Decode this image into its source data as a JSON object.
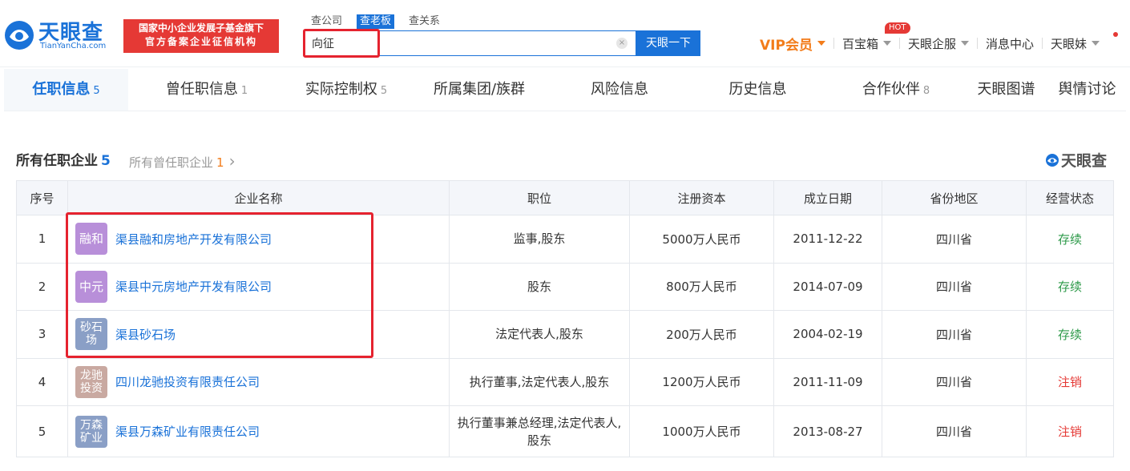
{
  "header": {
    "logo_cn": "天眼查",
    "logo_en": "TianYanCha.com",
    "banner_line1": "国家中小企业发展子基金旗下",
    "banner_line2": "官方备案企业征信机构",
    "search_tabs": [
      "查公司",
      "查老板",
      "查关系"
    ],
    "search_value": "向征",
    "clear_glyph": "×",
    "search_button": "天眼一下",
    "nav": {
      "vip": "VIP会员",
      "hot_badge": "HOT",
      "baibaoxiang": "百宝箱",
      "qifu": "天眼企服",
      "messages": "消息中心",
      "user": "天眼妹"
    }
  },
  "tabs": [
    {
      "label": "任职信息",
      "count": "5"
    },
    {
      "label": "曾任职信息",
      "count": "1"
    },
    {
      "label": "实际控制权",
      "count": "5"
    },
    {
      "label": "所属集团/族群",
      "count": ""
    },
    {
      "label": "风险信息",
      "count": ""
    },
    {
      "label": "历史信息",
      "count": ""
    },
    {
      "label": "合作伙伴",
      "count": "8"
    },
    {
      "label": "天眼图谱",
      "count": ""
    },
    {
      "label": "舆情讨论",
      "count": ""
    }
  ],
  "section": {
    "title": "所有任职企业",
    "count": "5",
    "sub_label": "所有曾任职企业",
    "sub_count": "1",
    "chevron": "›",
    "watermark": "天眼查"
  },
  "table": {
    "headers": [
      "序号",
      "企业名称",
      "职位",
      "注册资本",
      "成立日期",
      "省份地区",
      "经营状态"
    ],
    "rows": [
      {
        "no": "1",
        "avatar_l1": "融和",
        "avatar_l2": "",
        "avatar_color": "#b88fd9",
        "name": "渠县融和房地产开发有限公司",
        "position": "监事,股东",
        "capital": "5000万人民币",
        "date": "2011-12-22",
        "region": "四川省",
        "status": "存续",
        "status_color": "green"
      },
      {
        "no": "2",
        "avatar_l1": "中元",
        "avatar_l2": "",
        "avatar_color": "#b88fd9",
        "name": "渠县中元房地产开发有限公司",
        "position": "股东",
        "capital": "800万人民币",
        "date": "2014-07-09",
        "region": "四川省",
        "status": "存续",
        "status_color": "green"
      },
      {
        "no": "3",
        "avatar_l1": "砂石",
        "avatar_l2": "场",
        "avatar_color": "#8a9fc6",
        "name": "渠县砂石场",
        "position": "法定代表人,股东",
        "capital": "200万人民币",
        "date": "2004-02-19",
        "region": "四川省",
        "status": "存续",
        "status_color": "green"
      },
      {
        "no": "4",
        "avatar_l1": "龙驰",
        "avatar_l2": "投资",
        "avatar_color": "#c9a9a1",
        "name": "四川龙驰投资有限责任公司",
        "position": "执行董事,法定代表人,股东",
        "capital": "1200万人民币",
        "date": "2011-11-09",
        "region": "四川省",
        "status": "注销",
        "status_color": "red"
      },
      {
        "no": "5",
        "avatar_l1": "万森",
        "avatar_l2": "矿业",
        "avatar_color": "#8a9fc6",
        "name": "渠县万森矿业有限责任公司",
        "position": "执行董事兼总经理,法定代表人,股东",
        "capital": "1000万人民币",
        "date": "2013-08-27",
        "region": "四川省",
        "status": "注销",
        "status_color": "red"
      }
    ]
  },
  "colors": {
    "brand": "#1a72d8",
    "highlight_box": "#e5232f",
    "status_active": "#2e9a4a",
    "status_cancelled": "#e53935"
  }
}
